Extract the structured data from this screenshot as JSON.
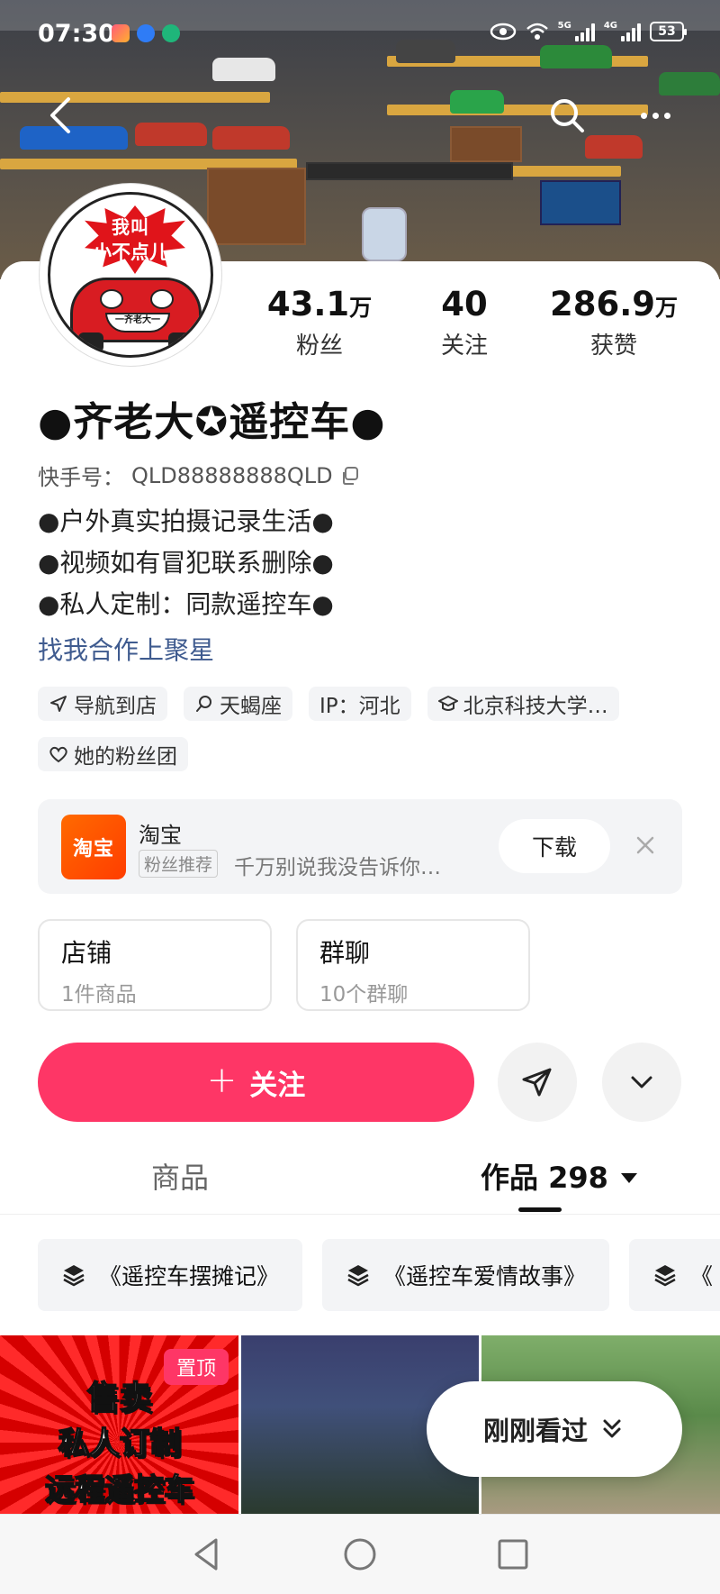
{
  "status_bar": {
    "time": "07:30",
    "battery": "53",
    "net_1": "5G",
    "net_2": "4G"
  },
  "header": {
    "back_icon": "chevron-left-icon",
    "search_icon": "search-icon",
    "more_icon": "more-dots-icon"
  },
  "avatar": {
    "text_line1": "我叫",
    "text_line2": "小不点儿",
    "plate": "一齐老大一"
  },
  "stats": [
    {
      "value": "43.1",
      "unit": "万",
      "label": "粉丝"
    },
    {
      "value": "40",
      "unit": "",
      "label": "关注"
    },
    {
      "value": "286.9",
      "unit": "万",
      "label": "获赞"
    }
  ],
  "profile": {
    "nickname": "●齐老大✪遥控车●",
    "id_label": "快手号：",
    "id_value": "QLD88888888QLD",
    "bio": [
      "●户外真实拍摄记录生活●",
      "●视频如有冒犯联系删除●",
      "●私人定制：同款遥控车●"
    ],
    "collab_link": "找我合作上聚星"
  },
  "tags": [
    {
      "icon": "navigation-arrow-icon",
      "label": "导航到店"
    },
    {
      "icon": "search-constellation-icon",
      "label": "天蝎座"
    },
    {
      "icon": "",
      "label": "IP：河北"
    },
    {
      "icon": "graduation-cap-icon",
      "label": "北京科技大学…"
    },
    {
      "icon": "heart-icon",
      "label": "她的粉丝团"
    }
  ],
  "promo": {
    "logo_text": "淘宝",
    "app_name": "淘宝",
    "badge": "粉丝推荐",
    "description": "千万别说我没告诉你…",
    "download_label": "下载",
    "brand_color": "#ff5000"
  },
  "cards": [
    {
      "title": "店铺",
      "subtitle": "1件商品"
    },
    {
      "title": "群聊",
      "subtitle": "10个群聊"
    }
  ],
  "actions": {
    "follow_label": "关注",
    "follow_color": "#fe3666",
    "share_icon": "paper-plane-icon",
    "expand_icon": "chevron-down-icon"
  },
  "tabs": [
    {
      "label": "商品",
      "active": false
    },
    {
      "label": "作品 298",
      "active": true
    }
  ],
  "collections": [
    {
      "icon": "layers-icon",
      "label": "《遥控车摆摊记》"
    },
    {
      "icon": "layers-icon",
      "label": "《遥控车爱情故事》"
    },
    {
      "icon": "layers-icon",
      "label": "《"
    }
  ],
  "videos": {
    "first_lines": [
      "售卖",
      "私人订制",
      "远程遥控车"
    ],
    "pin_badge": "置顶",
    "recent_label": "刚刚看过"
  },
  "system_nav": {
    "back_icon": "triangle-back-icon",
    "home_icon": "circle-home-icon",
    "recents_icon": "square-recents-icon"
  }
}
